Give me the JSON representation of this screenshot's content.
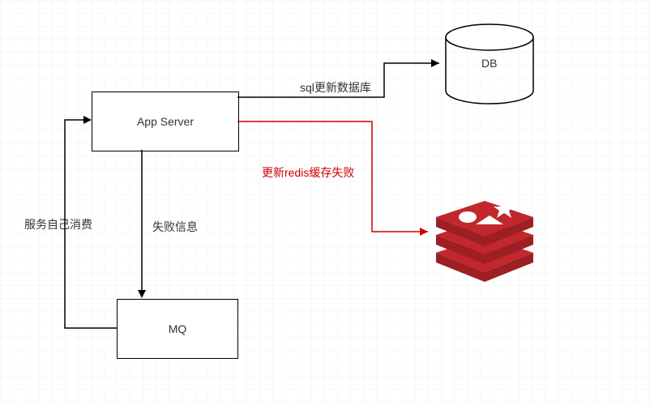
{
  "nodes": {
    "app_server": "App Server",
    "mq": "MQ",
    "db": "DB"
  },
  "edges": {
    "sql_update": "sql更新数据库",
    "redis_fail": "更新redis缓存失败",
    "fail_info": "失败信息",
    "self_consume": "服务自己消费"
  },
  "colors": {
    "redis": "#c1272d",
    "error": "#c00"
  }
}
